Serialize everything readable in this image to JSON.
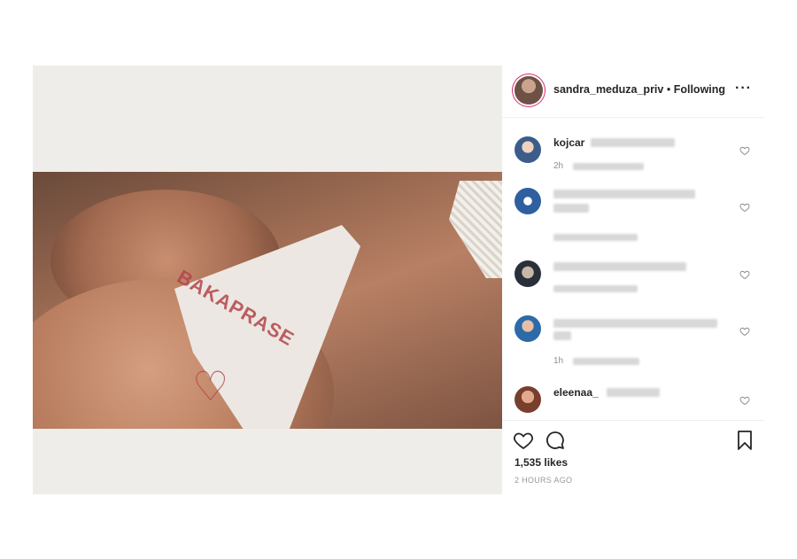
{
  "post": {
    "username": "sandra_meduza_priv",
    "separator": "•",
    "follow_status": "Following",
    "more_label": "···",
    "photo_text": "BAKAPRASE",
    "photo_heart": "♡"
  },
  "comments": [
    {
      "user": "kojcar",
      "time": "2h",
      "avatar_icon": "avatar-1"
    },
    {
      "user": "",
      "time": "",
      "avatar_icon": "avatar-2"
    },
    {
      "user": "",
      "time": "",
      "avatar_icon": "avatar-3"
    },
    {
      "user": "",
      "time": "1h",
      "avatar_icon": "avatar-4"
    },
    {
      "user": "eleenaa_",
      "time": "",
      "avatar_icon": "avatar-5"
    }
  ],
  "actions": {
    "likes": "1,535 likes",
    "time_ago": "2 HOURS AGO",
    "icons": [
      "heart-icon",
      "comment-icon",
      "bookmark-icon"
    ]
  },
  "colors": {
    "text": "#262626",
    "muted": "#8e8e8e",
    "border": "#efefef",
    "story_ring": "#d62976"
  }
}
